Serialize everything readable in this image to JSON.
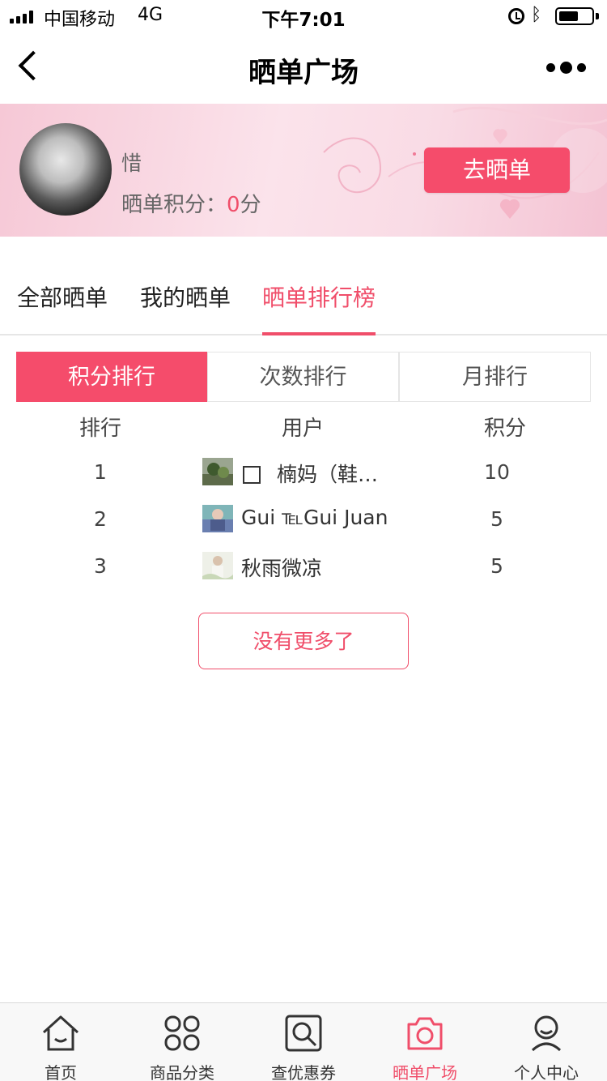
{
  "status_bar": {
    "carrier": "中国移动",
    "network": "4G",
    "time": "下午7:01",
    "battery_level": 0.6
  },
  "nav": {
    "title": "晒单广场"
  },
  "profile": {
    "name": "惜",
    "score_label": "晒单积分：",
    "score_value": "0",
    "score_unit": "分",
    "action_button": "去晒单"
  },
  "tabs": [
    {
      "label": "全部晒单",
      "active": false
    },
    {
      "label": "我的晒单",
      "active": false
    },
    {
      "label": "晒单排行榜",
      "active": true
    }
  ],
  "segments": [
    {
      "label": "积分排行",
      "active": true
    },
    {
      "label": "次数排行",
      "active": false
    },
    {
      "label": "月排行",
      "active": false
    }
  ],
  "ranking": {
    "headers": {
      "rank": "排行",
      "user": "用户",
      "score": "积分"
    },
    "rows": [
      {
        "rank": "1",
        "user": "楠妈（鞋…",
        "score": "10"
      },
      {
        "rank": "2",
        "user": "Gui ℡Gui Juan",
        "score": "5"
      },
      {
        "rank": "3",
        "user": "秋雨微凉",
        "score": "5"
      }
    ]
  },
  "no_more": "没有更多了",
  "tab_bar": [
    {
      "label": "首页",
      "icon": "home-icon",
      "active": false
    },
    {
      "label": "商品分类",
      "icon": "category-icon",
      "active": false
    },
    {
      "label": "查优惠券",
      "icon": "coupon-search-icon",
      "active": false
    },
    {
      "label": "晒单广场",
      "icon": "camera-icon",
      "active": true
    },
    {
      "label": "个人中心",
      "icon": "user-icon",
      "active": false
    }
  ],
  "colors": {
    "accent": "#f04e6a",
    "banner": "#f9dbe5"
  }
}
